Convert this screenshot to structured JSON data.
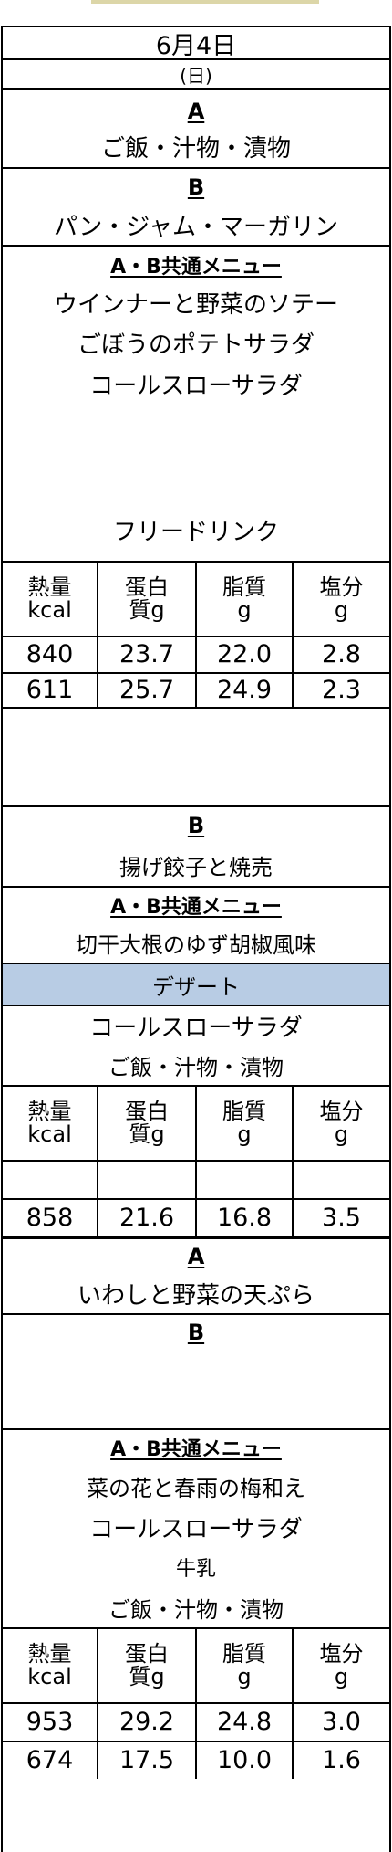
{
  "date": "6月4日",
  "weekday": "(日)",
  "breakfast": {
    "a_label": "A",
    "a_menu": "ご飯・汁物・漬物",
    "b_label": "B",
    "b_menu": "パン・ジャム・マーガリン",
    "common_label": "A・B共通メニュー",
    "common_items": [
      "ウインナーと野菜のソテー",
      "ごぼうのポテトサラダ",
      "コールスローサラダ",
      "フリードリンク"
    ]
  },
  "nutrition_headers": {
    "energy": [
      "熱量",
      "kcal"
    ],
    "protein": [
      "蛋白",
      "質g"
    ],
    "fat": [
      "脂質",
      "g"
    ],
    "salt": [
      "塩分",
      "g"
    ]
  },
  "breakfast_nutrition": [
    [
      "840",
      "23.7",
      "22.0",
      "2.8"
    ],
    [
      "611",
      "25.7",
      "24.9",
      "2.3"
    ]
  ],
  "lunch": {
    "b_label": "B",
    "b_menu": "揚げ餃子と焼売",
    "common_label": "A・B共通メニュー",
    "common_item1": "切干大根のゆず胡椒風味",
    "dessert_label": "デザート",
    "common_item2": "コールスローサラダ",
    "common_item3": "ご飯・汁物・漬物"
  },
  "lunch_nutrition": [
    [
      "",
      "",
      "",
      ""
    ],
    [
      "858",
      "21.6",
      "16.8",
      "3.5"
    ]
  ],
  "dinner": {
    "a_label": "A",
    "a_menu": "いわしと野菜の天ぷら",
    "b_label": "B",
    "common_label": "A・B共通メニュー",
    "common_items": [
      "菜の花と春雨の梅和え",
      "コールスローサラダ",
      "牛乳",
      "ご飯・汁物・漬物"
    ]
  },
  "dinner_nutrition": [
    [
      "953",
      "29.2",
      "24.8",
      "3.0"
    ],
    [
      "674",
      "17.5",
      "10.0",
      "1.6"
    ]
  ]
}
